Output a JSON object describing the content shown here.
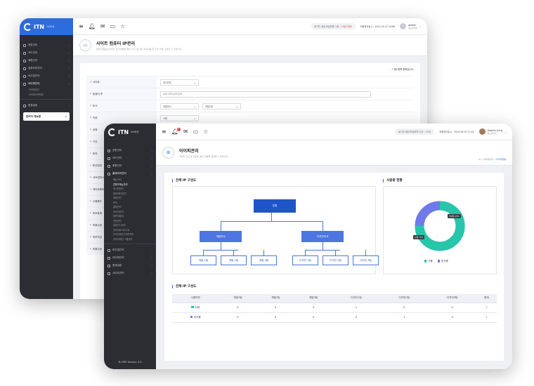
{
  "app": {
    "logo": "ITN",
    "logo_sub": "아이티앤",
    "version": "N-CMS Version 3.0"
  },
  "colors": {
    "accent": "#2d6cdf",
    "node_top": "#1e55c9",
    "node_mid": "#4e76e0",
    "teal": "#26c6aa",
    "purple": "#7079e8",
    "sidebar": "#2b2d33",
    "danger": "#e23b3b"
  },
  "back": {
    "sidebar": {
      "items": [
        {
          "label": "권한관리",
          "icon": "check-circle-icon"
        },
        {
          "label": "코드관리",
          "icon": "code-icon"
        },
        {
          "label": "회원관리",
          "icon": "user-icon"
        },
        {
          "label": "컴퓨터이관리",
          "icon": "monitor-icon"
        },
        {
          "label": "비주얼관리",
          "icon": "image-icon"
        },
        {
          "label": "아이피관리",
          "icon": "users-icon",
          "active": true
        }
      ],
      "subitems": [
        "아이피관리",
        "아이피이력조회"
      ],
      "bottom_item": {
        "label": "환경설정",
        "icon": "gear-icon"
      },
      "admin_menu": "관리자 메뉴얼"
    },
    "header": {
      "session": "로그인 세션 타임아웃 시간 :",
      "session_time": "19분 58초",
      "last_login": "최종접속일시 : 2021-02-22 16:86",
      "user_name": "admin",
      "user_role": "최고관리자"
    },
    "page": {
      "title": "사이트 컴퓨터 IP관리",
      "desc": "현재 사용중인 아이피 및 IP현황을 확인 할 수 있으며, 아이피를 추가 및 삭제, 수정할 수 있습니다."
    },
    "form": {
      "required_note": "필수항목 항목입니다.",
      "rows": [
        {
          "label": "사이트",
          "value": "최고관리",
          "type": "select"
        },
        {
          "label": "컴퓨터 IP",
          "value": "123.123.123.122",
          "type": "input"
        },
        {
          "label": "부서",
          "value": "개발부서",
          "value2": "개발1팀",
          "type": "select2"
        },
        {
          "label": "직위",
          "value": "사원",
          "type": "select"
        },
        {
          "label": "성명",
          "value": "",
          "type": "none"
        },
        {
          "label": "기간",
          "value": "",
          "type": "none"
        },
        {
          "label": "위치",
          "value": "",
          "type": "none"
        },
        {
          "label": "랜선위치",
          "value": "",
          "type": "none"
        },
        {
          "label": "서브넷마스크",
          "value": "",
          "type": "none"
        },
        {
          "label": "게이트웨이",
          "value": "",
          "type": "none"
        },
        {
          "label": "사용용도",
          "value": "",
          "type": "none"
        },
        {
          "label": "최초등록",
          "value": "",
          "type": "none"
        },
        {
          "label": "최종수정",
          "value": "",
          "type": "none"
        },
        {
          "label": "최초작성",
          "value": "",
          "type": "none"
        },
        {
          "label": "최종수정",
          "value": "",
          "type": "none"
        }
      ]
    }
  },
  "front": {
    "sidebar": {
      "items": [
        {
          "label": "권한관리",
          "icon": "check-circle-icon"
        },
        {
          "label": "코드관리",
          "icon": "code-icon"
        },
        {
          "label": "회원관리",
          "icon": "user-icon"
        },
        {
          "label": "홈페이지관리",
          "icon": "monitor-icon",
          "active": true
        }
      ],
      "subitems": [
        "메뉴관리",
        "콘텐츠메뉴관리",
        "게시판관리",
        "팝업/배너관리",
        "회원관리",
        "포토",
        "결제관리",
        "관리자관리",
        "방문자통계",
        "약관관리",
        "일정이시관리",
        "관리자로그리스트",
        "관리자메인그래프관리",
        "관리자메인 그룹관리"
      ],
      "current_sub": 1,
      "bottom_items": [
        {
          "label": "비주얼관리",
          "icon": "image-icon"
        },
        {
          "label": "아이피관리",
          "icon": "users-icon"
        },
        {
          "label": "환경설정",
          "icon": "gear-icon"
        },
        {
          "label": "사이트관리",
          "icon": "globe-icon"
        }
      ]
    },
    "header": {
      "notif_count": "3",
      "session": "로그인 세션 타임아웃 시간 : 1시간",
      "last_login": "최종접속일시 : 2020-06-02 11:40",
      "user_name": "Soobin Jung",
      "user_role": "최고관리자"
    },
    "page": {
      "title": "아이피관리",
      "desc": "아이피 구성 및 사용현, 활당 현황을 살펴볼 수 있습니다.",
      "breadcrumb_mid": "아이피관리",
      "breadcrumb_cur": "아이피현황"
    },
    "org": {
      "title": "전체 IP 구성도",
      "root": "임원",
      "depts": [
        {
          "name": "개발부서",
          "teams": [
            "개발 1팀",
            "개발 2팀",
            "개발 3팀"
          ]
        },
        {
          "name": "디자인부서",
          "teams": [
            "디자인 1팀",
            "디자인 2팀",
            "디자인 3팀"
          ]
        }
      ]
    },
    "usage": {
      "title": "사용량 현황",
      "used_label": "사용",
      "unused_label": "미사용",
      "used_pct_label": "사용 75%",
      "unused_pct_label": "미사용 25%",
      "used_fraction": 0.75
    },
    "table": {
      "title": "전체 IP 구성도",
      "headers": [
        "사용여부",
        "개발1팀",
        "개발2팀",
        "개발3팀",
        "디자인1팀",
        "디자인2팀",
        "디자인3팀",
        "합계"
      ],
      "rows": [
        {
          "label": "사용",
          "values": [
            "4",
            "0",
            "3",
            "1",
            "0",
            "0"
          ],
          "total": "7"
        },
        {
          "label": "미사용",
          "values": [
            "0",
            "0",
            "0",
            "0",
            "1",
            "0"
          ],
          "total": "1"
        }
      ]
    }
  }
}
